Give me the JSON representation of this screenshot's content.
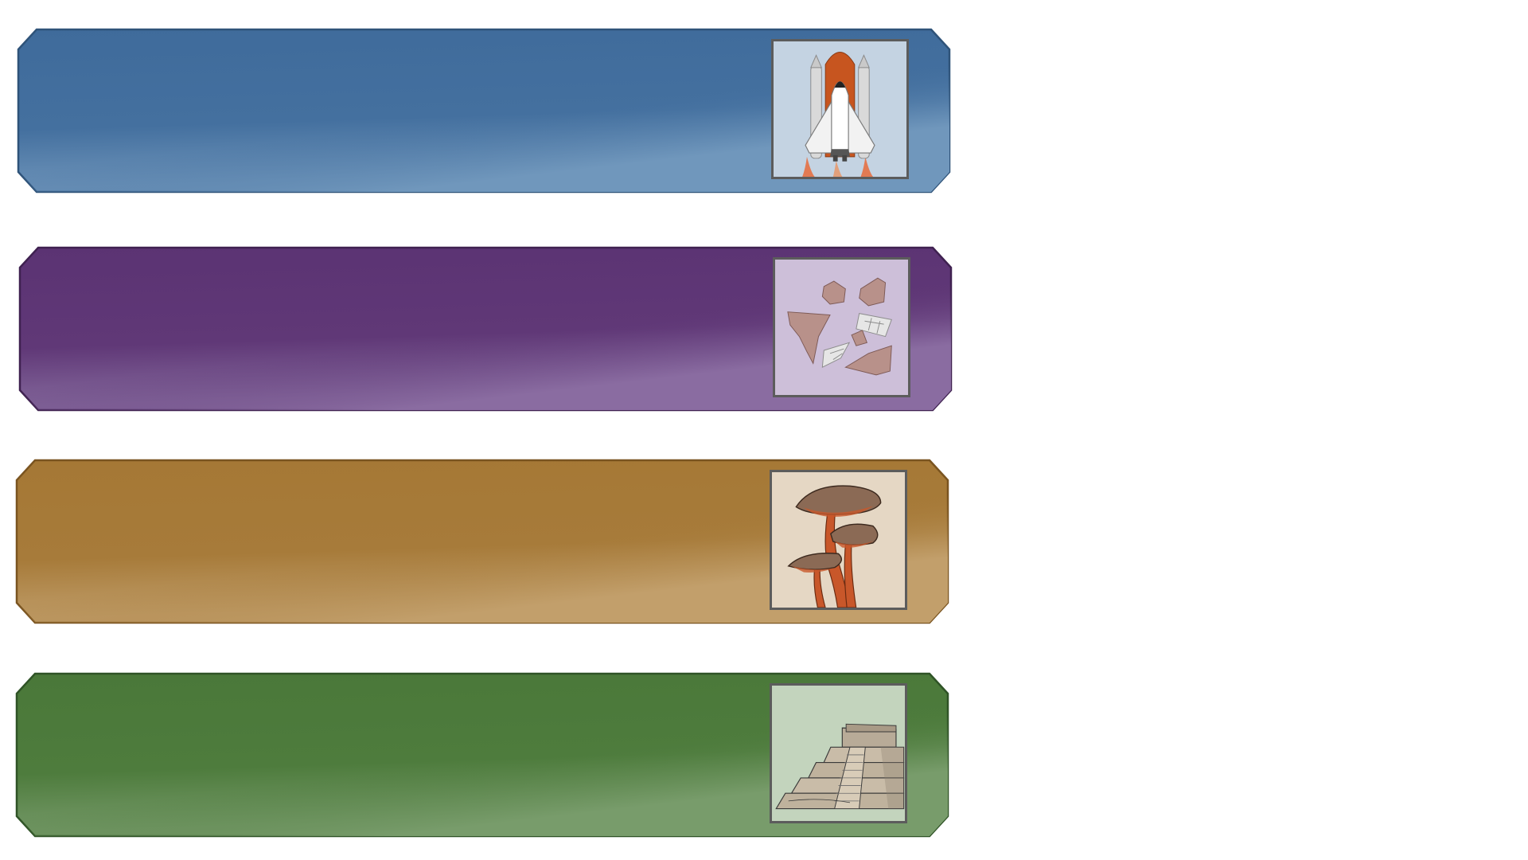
{
  "banners": [
    {
      "id": "space",
      "icon": "space-shuttle-icon",
      "colors": {
        "main": "#436f9e",
        "light": "#6c92b8",
        "border": "#2f5379",
        "thumb_bg": "#c4d3e2"
      }
    },
    {
      "id": "fragments",
      "icon": "rock-fragments-icon",
      "colors": {
        "main": "#5f3775",
        "light": "#83679b",
        "border": "#3f2150",
        "thumb_bg": "#cdbfd9"
      }
    },
    {
      "id": "fungi",
      "icon": "giant-mushroom-icon",
      "colors": {
        "main": "#a67a38",
        "light": "#bf9c68",
        "border": "#7a5420",
        "thumb_bg": "#e5d7c4"
      }
    },
    {
      "id": "ancient",
      "icon": "stepped-pyramid-icon",
      "colors": {
        "main": "#4c7a3b",
        "light": "#749867",
        "border": "#2f5326",
        "thumb_bg": "#c3d4bd"
      }
    }
  ]
}
